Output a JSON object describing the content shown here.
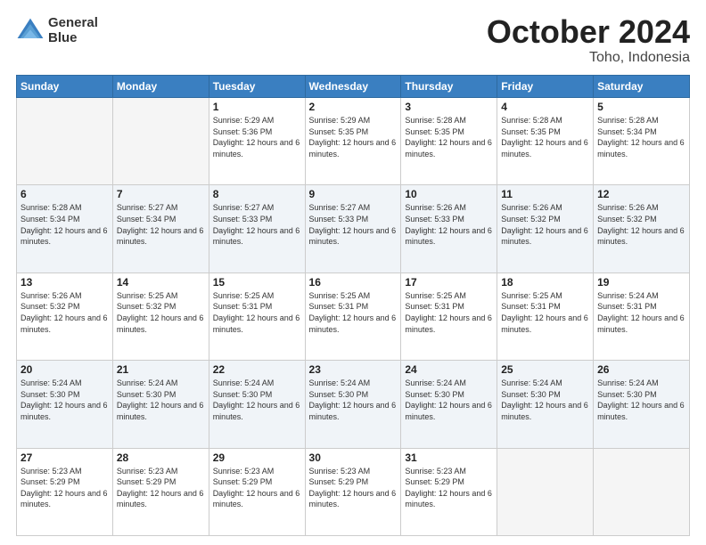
{
  "logo": {
    "line1": "General",
    "line2": "Blue"
  },
  "title": "October 2024",
  "subtitle": "Toho, Indonesia",
  "days_of_week": [
    "Sunday",
    "Monday",
    "Tuesday",
    "Wednesday",
    "Thursday",
    "Friday",
    "Saturday"
  ],
  "weeks": [
    [
      {
        "day": "",
        "empty": true
      },
      {
        "day": "",
        "empty": true
      },
      {
        "day": "1",
        "sunrise": "5:29 AM",
        "sunset": "5:36 PM",
        "daylight": "12 hours and 6 minutes."
      },
      {
        "day": "2",
        "sunrise": "5:29 AM",
        "sunset": "5:35 PM",
        "daylight": "12 hours and 6 minutes."
      },
      {
        "day": "3",
        "sunrise": "5:28 AM",
        "sunset": "5:35 PM",
        "daylight": "12 hours and 6 minutes."
      },
      {
        "day": "4",
        "sunrise": "5:28 AM",
        "sunset": "5:35 PM",
        "daylight": "12 hours and 6 minutes."
      },
      {
        "day": "5",
        "sunrise": "5:28 AM",
        "sunset": "5:34 PM",
        "daylight": "12 hours and 6 minutes."
      }
    ],
    [
      {
        "day": "6",
        "sunrise": "5:28 AM",
        "sunset": "5:34 PM",
        "daylight": "12 hours and 6 minutes."
      },
      {
        "day": "7",
        "sunrise": "5:27 AM",
        "sunset": "5:34 PM",
        "daylight": "12 hours and 6 minutes."
      },
      {
        "day": "8",
        "sunrise": "5:27 AM",
        "sunset": "5:33 PM",
        "daylight": "12 hours and 6 minutes."
      },
      {
        "day": "9",
        "sunrise": "5:27 AM",
        "sunset": "5:33 PM",
        "daylight": "12 hours and 6 minutes."
      },
      {
        "day": "10",
        "sunrise": "5:26 AM",
        "sunset": "5:33 PM",
        "daylight": "12 hours and 6 minutes."
      },
      {
        "day": "11",
        "sunrise": "5:26 AM",
        "sunset": "5:32 PM",
        "daylight": "12 hours and 6 minutes."
      },
      {
        "day": "12",
        "sunrise": "5:26 AM",
        "sunset": "5:32 PM",
        "daylight": "12 hours and 6 minutes."
      }
    ],
    [
      {
        "day": "13",
        "sunrise": "5:26 AM",
        "sunset": "5:32 PM",
        "daylight": "12 hours and 6 minutes."
      },
      {
        "day": "14",
        "sunrise": "5:25 AM",
        "sunset": "5:32 PM",
        "daylight": "12 hours and 6 minutes."
      },
      {
        "day": "15",
        "sunrise": "5:25 AM",
        "sunset": "5:31 PM",
        "daylight": "12 hours and 6 minutes."
      },
      {
        "day": "16",
        "sunrise": "5:25 AM",
        "sunset": "5:31 PM",
        "daylight": "12 hours and 6 minutes."
      },
      {
        "day": "17",
        "sunrise": "5:25 AM",
        "sunset": "5:31 PM",
        "daylight": "12 hours and 6 minutes."
      },
      {
        "day": "18",
        "sunrise": "5:25 AM",
        "sunset": "5:31 PM",
        "daylight": "12 hours and 6 minutes."
      },
      {
        "day": "19",
        "sunrise": "5:24 AM",
        "sunset": "5:31 PM",
        "daylight": "12 hours and 6 minutes."
      }
    ],
    [
      {
        "day": "20",
        "sunrise": "5:24 AM",
        "sunset": "5:30 PM",
        "daylight": "12 hours and 6 minutes."
      },
      {
        "day": "21",
        "sunrise": "5:24 AM",
        "sunset": "5:30 PM",
        "daylight": "12 hours and 6 minutes."
      },
      {
        "day": "22",
        "sunrise": "5:24 AM",
        "sunset": "5:30 PM",
        "daylight": "12 hours and 6 minutes."
      },
      {
        "day": "23",
        "sunrise": "5:24 AM",
        "sunset": "5:30 PM",
        "daylight": "12 hours and 6 minutes."
      },
      {
        "day": "24",
        "sunrise": "5:24 AM",
        "sunset": "5:30 PM",
        "daylight": "12 hours and 6 minutes."
      },
      {
        "day": "25",
        "sunrise": "5:24 AM",
        "sunset": "5:30 PM",
        "daylight": "12 hours and 6 minutes."
      },
      {
        "day": "26",
        "sunrise": "5:24 AM",
        "sunset": "5:30 PM",
        "daylight": "12 hours and 6 minutes."
      }
    ],
    [
      {
        "day": "27",
        "sunrise": "5:23 AM",
        "sunset": "5:29 PM",
        "daylight": "12 hours and 6 minutes."
      },
      {
        "day": "28",
        "sunrise": "5:23 AM",
        "sunset": "5:29 PM",
        "daylight": "12 hours and 6 minutes."
      },
      {
        "day": "29",
        "sunrise": "5:23 AM",
        "sunset": "5:29 PM",
        "daylight": "12 hours and 6 minutes."
      },
      {
        "day": "30",
        "sunrise": "5:23 AM",
        "sunset": "5:29 PM",
        "daylight": "12 hours and 6 minutes."
      },
      {
        "day": "31",
        "sunrise": "5:23 AM",
        "sunset": "5:29 PM",
        "daylight": "12 hours and 6 minutes."
      },
      {
        "day": "",
        "empty": true
      },
      {
        "day": "",
        "empty": true
      }
    ]
  ]
}
